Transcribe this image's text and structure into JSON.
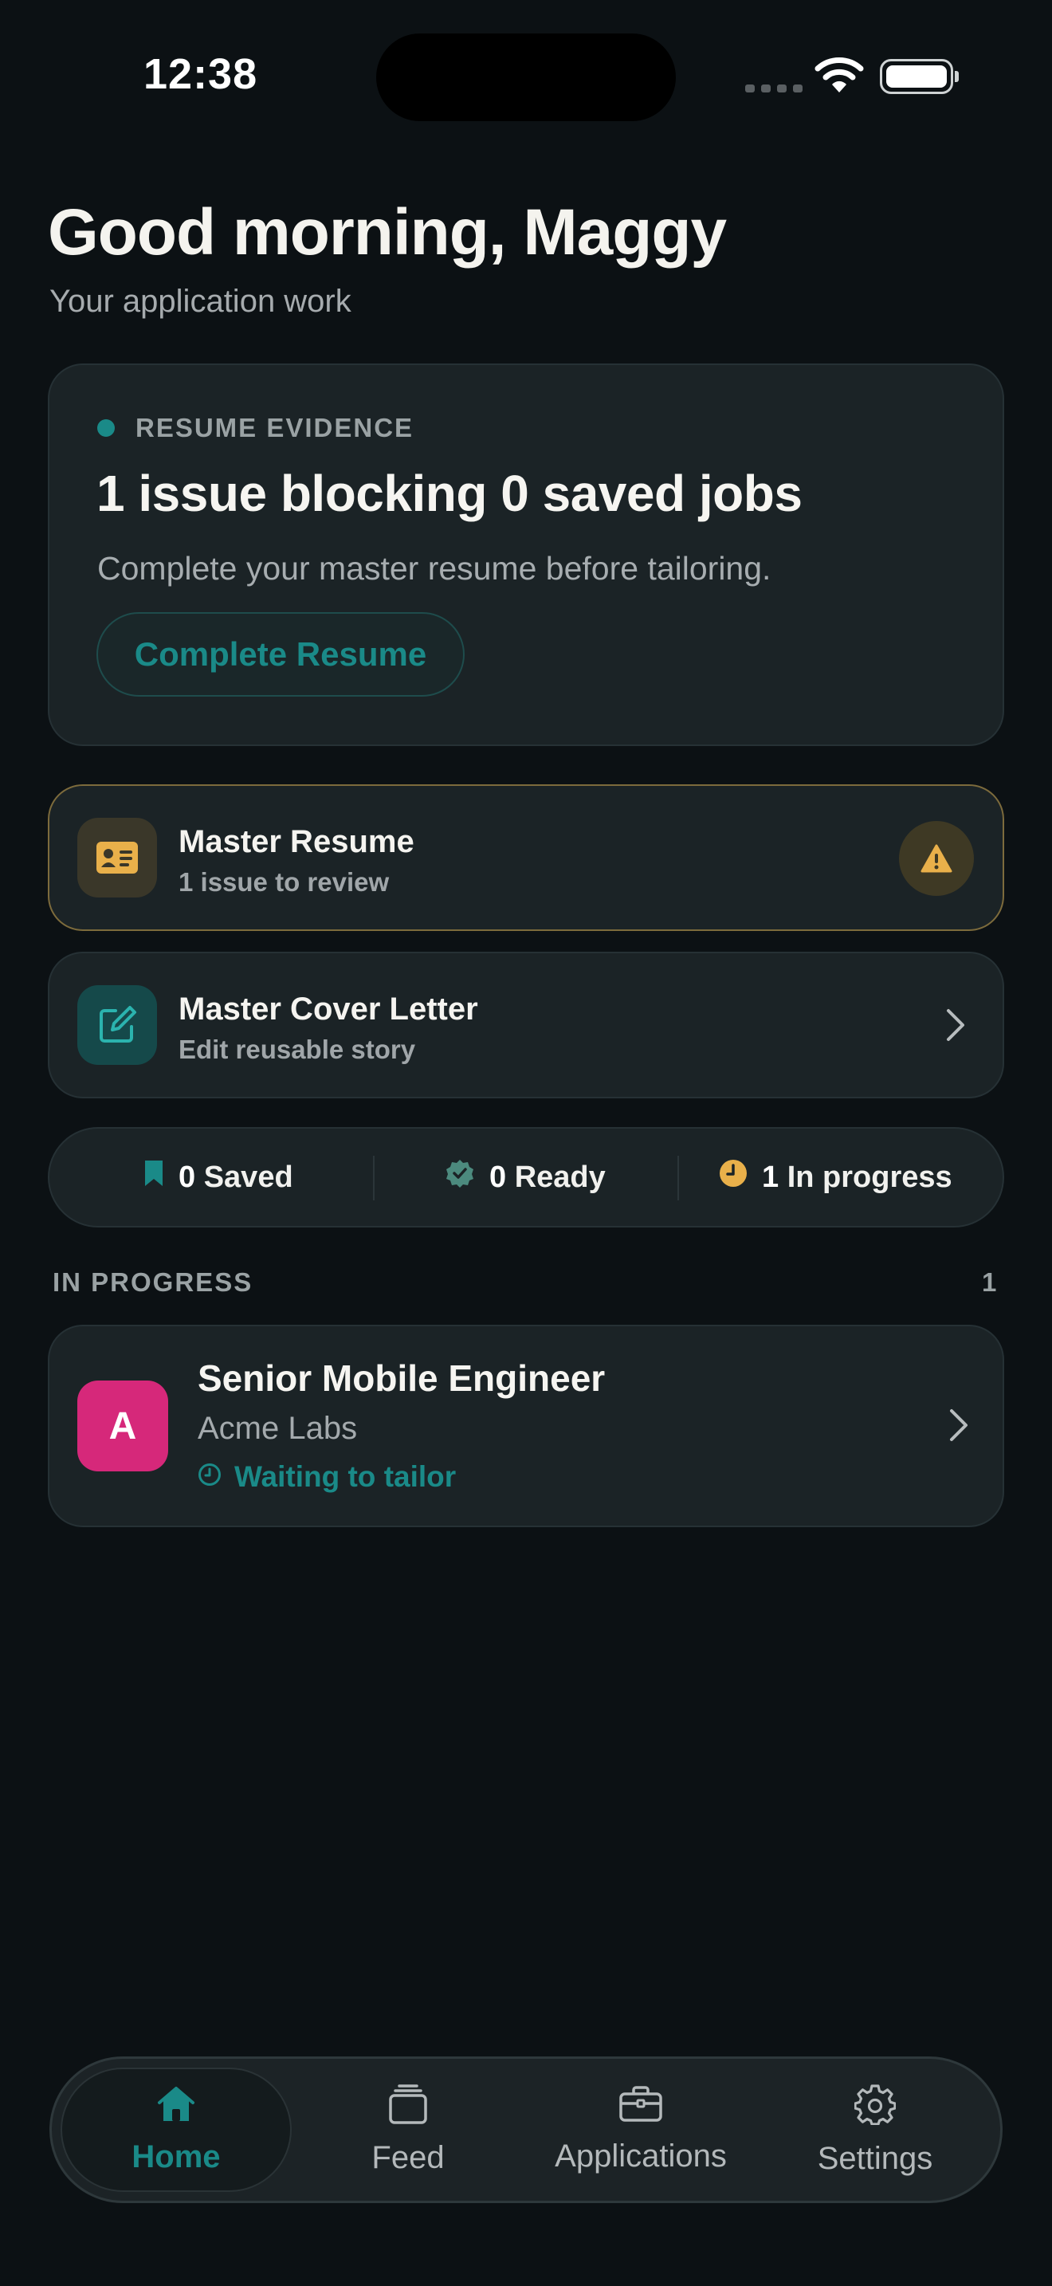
{
  "status_bar": {
    "time": "12:38"
  },
  "header": {
    "greeting": "Good morning, Maggy",
    "subtitle": "Your application work"
  },
  "evidence_card": {
    "label": "RESUME EVIDENCE",
    "title": "1 issue blocking 0 saved jobs",
    "description": "Complete your master resume before tailoring.",
    "button": "Complete Resume"
  },
  "master_resume": {
    "title": "Master Resume",
    "subtitle": "1 issue to review",
    "icon": "id-card-icon",
    "status_icon": "warning-icon"
  },
  "master_cover_letter": {
    "title": "Master Cover Letter",
    "subtitle": "Edit reusable story",
    "icon": "edit-icon"
  },
  "stats": [
    {
      "count": "0",
      "label": "Saved",
      "icon": "bookmark-icon"
    },
    {
      "count": "0",
      "label": "Ready",
      "icon": "verified-badge-icon"
    },
    {
      "count": "1",
      "label": "In progress",
      "icon": "clock-icon"
    }
  ],
  "in_progress_section": {
    "label": "IN PROGRESS",
    "count": "1"
  },
  "jobs": [
    {
      "initial": "A",
      "title": "Senior Mobile Engineer",
      "company": "Acme Labs",
      "status": "Waiting to tailor"
    }
  ],
  "tabs": [
    {
      "label": "Home",
      "icon": "home-icon",
      "active": true
    },
    {
      "label": "Feed",
      "icon": "stack-icon",
      "active": false
    },
    {
      "label": "Applications",
      "icon": "briefcase-icon",
      "active": false
    },
    {
      "label": "Settings",
      "icon": "gear-icon",
      "active": false
    }
  ],
  "colors": {
    "background": "#0c1114",
    "card": "#1b2326",
    "accent": "#1a8a88",
    "warning": "#e9b04a",
    "avatar": "#d6287a"
  }
}
